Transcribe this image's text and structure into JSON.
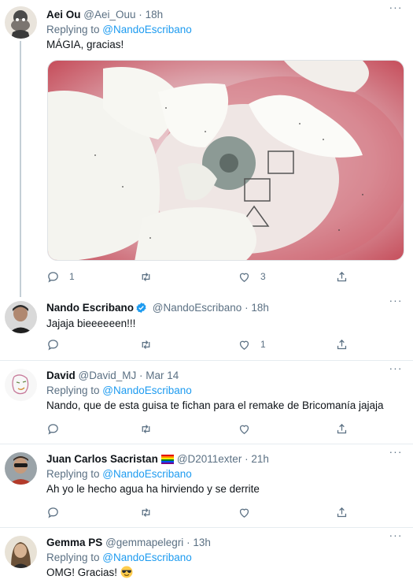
{
  "tweets": [
    {
      "name": "Aei Ou",
      "handle": "@Aei_Ouu",
      "time": "18h",
      "replying_prefix": "Replying to ",
      "replying_to": "@NandoEscribano",
      "text": "MÁGIA, gracias!",
      "replies": "1",
      "retweets": "",
      "likes": "3",
      "has_media": true
    },
    {
      "name": "Nando Escribano",
      "handle": "@NandoEscribano",
      "time": "18h",
      "verified": true,
      "text": "Jajaja bieeeeeen!!!",
      "replies": "",
      "retweets": "",
      "likes": "1"
    },
    {
      "name": "David",
      "handle": "@David_MJ",
      "time": "Mar 14",
      "replying_prefix": "Replying to ",
      "replying_to": "@NandoEscribano",
      "text": "Nando, que de esta guisa te fichan para el remake de Bricomanía jajaja",
      "replies": "",
      "retweets": "",
      "likes": ""
    },
    {
      "name": "Juan Carlos Sacristan",
      "handle": "@D2011exter",
      "time": "21h",
      "name_flag": "rainbow-flag",
      "replying_prefix": "Replying to ",
      "replying_to": "@NandoEscribano",
      "text": "Ah yo le hecho agua ha hirviendo y se derrite",
      "replies": "",
      "retweets": "",
      "likes": ""
    },
    {
      "name": "Gemma PS",
      "handle": "@gemmapelegri",
      "time": "13h",
      "replying_prefix": "Replying to ",
      "replying_to": "@NandoEscribano",
      "text": "OMG! Gracias!",
      "text_emoji": "smiling-face-with-sunglasses-emoji"
    }
  ],
  "separator": "·",
  "more_glyph": "···",
  "colors": {
    "link": "#1d9bf0",
    "secondary": "#5b7083",
    "verified": "#1d9bf0",
    "divider": "#e6ecf0"
  },
  "icons": {
    "reply": "reply-icon",
    "retweet": "retweet-icon",
    "like": "heart-icon",
    "share": "share-icon",
    "more": "more-icon",
    "verified": "verified-badge-icon"
  }
}
